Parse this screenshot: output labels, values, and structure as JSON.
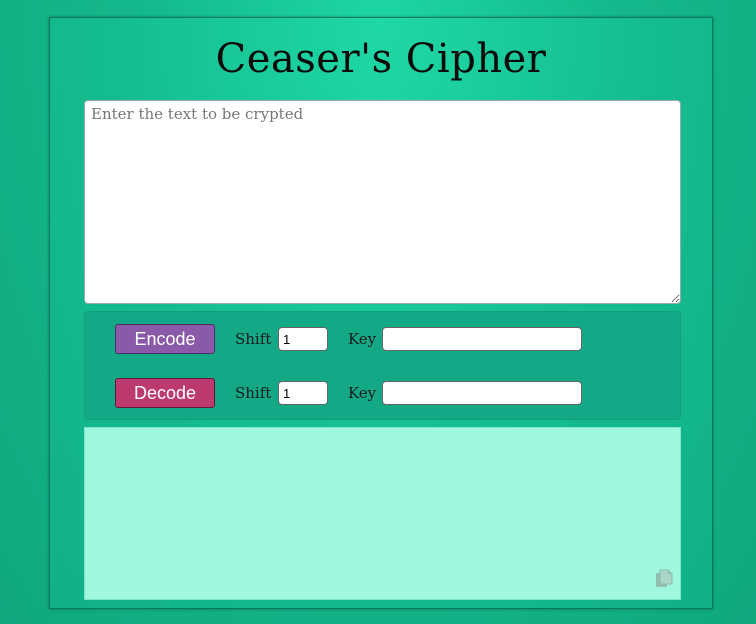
{
  "app": {
    "title": "Ceaser's Cipher"
  },
  "input": {
    "placeholder": "Enter the text to be crypted",
    "value": ""
  },
  "encode": {
    "button_label": "Encode",
    "shift_label": "Shift",
    "shift_value": "1",
    "key_label": "Key",
    "key_value": ""
  },
  "decode": {
    "button_label": "Decode",
    "shift_label": "Shift",
    "shift_value": "1",
    "key_label": "Key",
    "key_value": ""
  },
  "output": {
    "text": "",
    "copy_icon": "copy-icon"
  },
  "colors": {
    "background": "#14b88c",
    "encode_button": "#8a5aa8",
    "decode_button": "#bd3a70",
    "output_background": "#9ff7df"
  }
}
